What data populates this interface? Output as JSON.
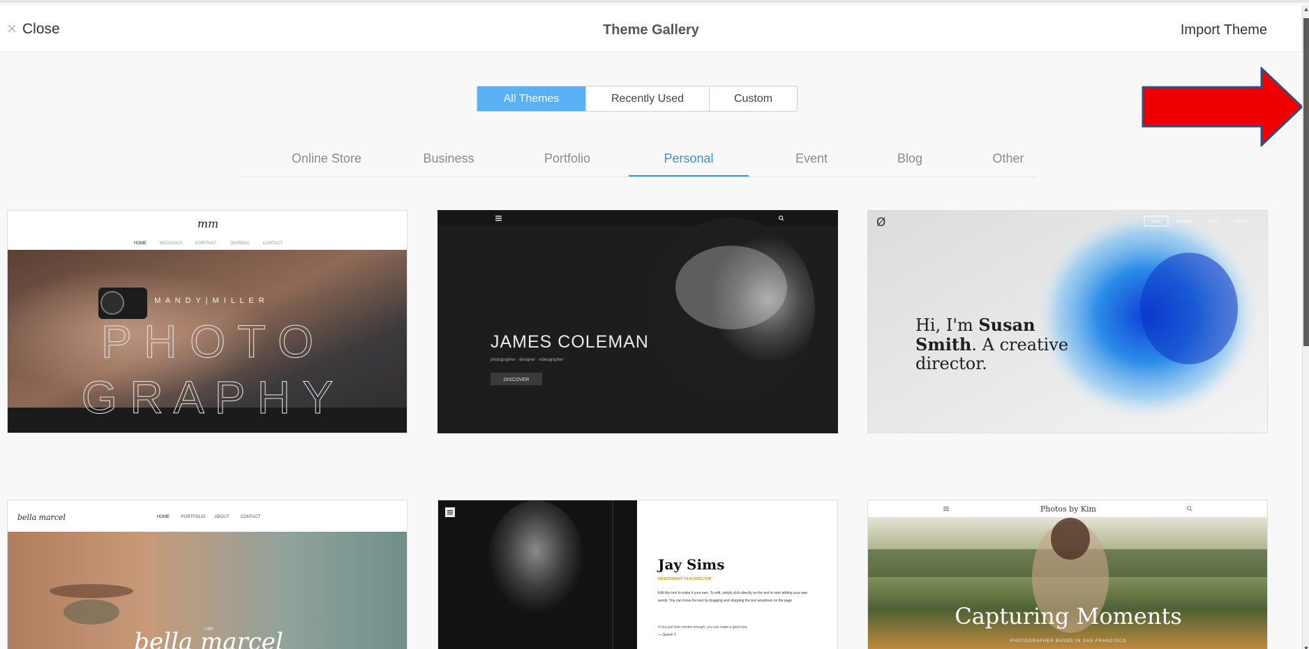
{
  "header": {
    "close_label": "Close",
    "close_icon": "×",
    "title": "Theme Gallery",
    "import_label": "Import Theme"
  },
  "filters": {
    "segments": [
      "All Themes",
      "Recently Used",
      "Custom"
    ],
    "active_segment": "All Themes"
  },
  "categories": {
    "items": [
      "Online Store",
      "Business",
      "Portfolio",
      "Personal",
      "Event",
      "Blog",
      "Other"
    ],
    "active": "Personal"
  },
  "themes": [
    {
      "logo": "mm",
      "nav": [
        "HOME",
        "WEDDINGS",
        "PORTRAIT",
        "JOURNAL",
        "CONTACT"
      ],
      "tagline": "M A N D Y | M I L L E R",
      "heading_line1": "P H O T O",
      "heading_line2": "G R A P H Y"
    },
    {
      "name": "JAMES COLEMAN",
      "subtitle": "photographer · designer · videographer",
      "button": "DISCOVER"
    },
    {
      "logo": "Ø",
      "nav": [
        "HOME",
        "MY WORK",
        "ABOUT",
        "CONTACT"
      ],
      "line1_pre": "Hi, I'm ",
      "line1_bold": "Susan",
      "line2_bold": "Smith",
      "line2_rest": ". A creative",
      "line3": "director."
    },
    {
      "logo": "bella marcel",
      "nav": [
        "HOME",
        "PORTFOLIO",
        "ABOUT",
        "CONTACT"
      ],
      "tag": "I AM",
      "script": "bella marcel"
    },
    {
      "name": "Jay Sims",
      "role": "INDEPENDENT FILM DIRECTOR",
      "body": "Edit this text to make it your own. To edit, simply click directly on the text to start adding your own words. You can move the text by dragging and dropping the text anywhere on the page.",
      "quote": "If you just love movies enough, you can make a good one.",
      "quote_author": "— Queen T."
    },
    {
      "site_title": "Photos by Kim",
      "heading": "Capturing Moments",
      "subheading": "PHOTOGRAPHER BASED IN SAN FRANCISCO"
    }
  ],
  "colors": {
    "accent": "#3d8fd6",
    "segment_active": "#58b0f5",
    "annotation_arrow": "#ee0000"
  },
  "icons": {
    "close": "close-icon",
    "menu": "hamburger-icon",
    "search": "search-icon",
    "annotation": "arrow-right-icon"
  }
}
